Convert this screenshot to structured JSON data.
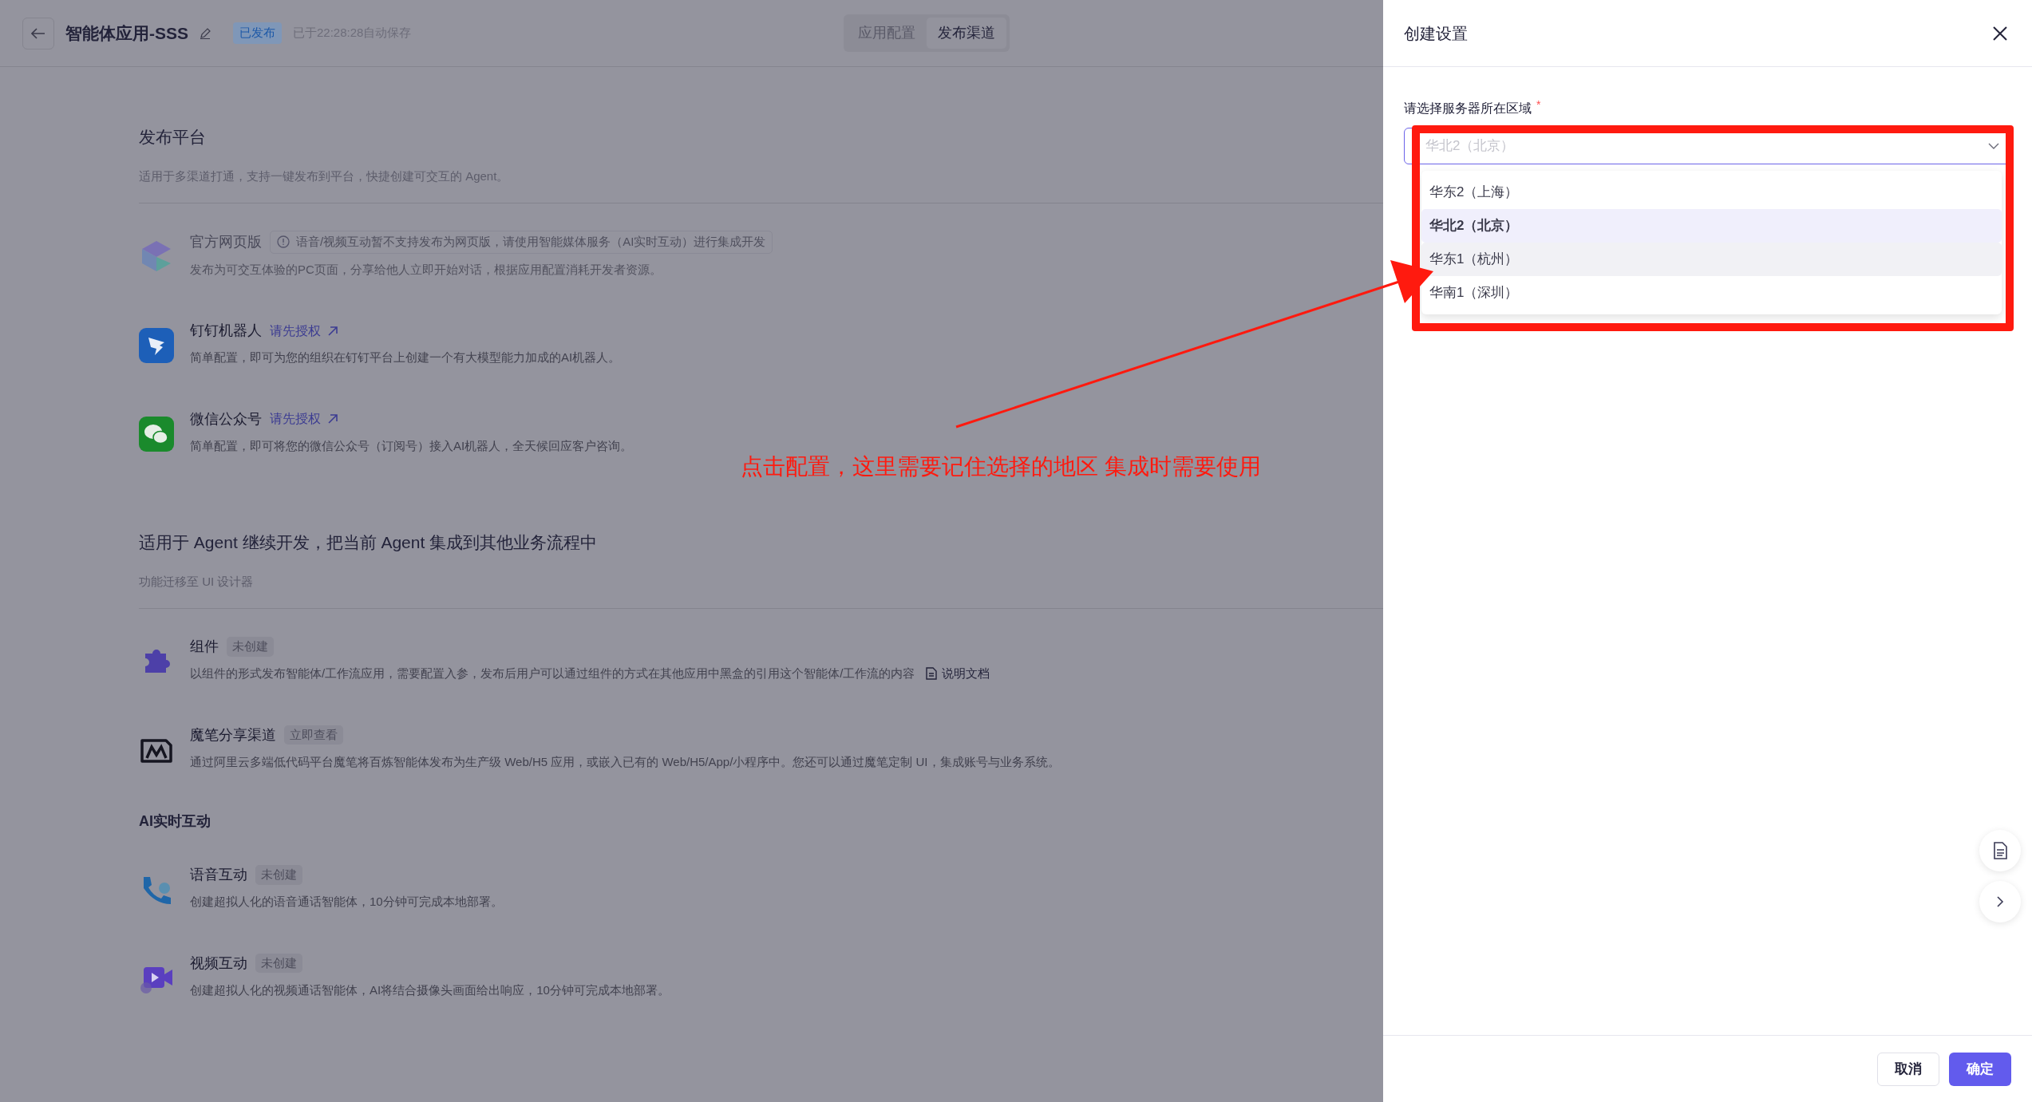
{
  "header": {
    "title": "智能体应用-SSS",
    "status_badge": "已发布",
    "autosave": "已于22:28:28自动保存",
    "tabs": [
      {
        "label": "应用配置",
        "selected": false
      },
      {
        "label": "发布渠道",
        "selected": true
      }
    ]
  },
  "sections": [
    {
      "kind": "group",
      "title": "发布平台",
      "subtitle": "适用于多渠道打通，支持一键发布到平台，快捷创建可交互的 Agent。",
      "items": [
        {
          "kind": "web",
          "name": "官方网页版",
          "disabled": true,
          "notice": "语音/视频互动暂不支持发布为网页版，请使用智能媒体服务（AI实时互动）进行集成开发",
          "description": "发布为可交互体验的PC页面，分享给他人立即开始对话，根据应用配置消耗开发者资源。"
        },
        {
          "kind": "dingtalk",
          "name": "钉钉机器人",
          "disabled": false,
          "link": "请先授权",
          "description": "简单配置，即可为您的组织在钉钉平台上创建一个有大模型能力加成的AI机器人。"
        },
        {
          "kind": "wechat",
          "name": "微信公众号",
          "disabled": false,
          "link": "请先授权",
          "description": "简单配置，即可将您的微信公众号（订阅号）接入AI机器人，全天候回应客户咨询。"
        }
      ]
    },
    {
      "kind": "group",
      "title": "适用于 Agent 继续开发，把当前 Agent 集成到其他业务流程中",
      "subtitle": "功能迁移至 UI 设计器",
      "items": [
        {
          "kind": "component",
          "name": "组件",
          "disabled": false,
          "badge": "未创建",
          "description": "以组件的形式发布智能体/工作流应用，需要配置入参，发布后用户可以通过组件的方式在其他应用中黑盒的引用这个智能体/工作流的内容",
          "doc_link": "说明文档"
        },
        {
          "kind": "mobi",
          "name": "魔笔分享渠道",
          "disabled": false,
          "badge": "立即查看",
          "description": "通过阿里云多端低代码平台魔笔将百炼智能体发布为生产级 Web/H5 应用，或嵌入已有的 Web/H5/App/小程序中。您还可以通过魔笔定制 UI，集成账号与业务系统。"
        }
      ]
    },
    {
      "kind": "subgroup",
      "title": "AI实时互动",
      "items": [
        {
          "kind": "voice",
          "name": "语音互动",
          "disabled": false,
          "badge": "未创建",
          "description": "创建超拟人化的语音通话智能体，10分钟可完成本地部署。"
        },
        {
          "kind": "video",
          "name": "视频互动",
          "disabled": false,
          "badge": "未创建",
          "description": "创建超拟人化的视频通话智能体，AI将结合摄像头画面给出响应，10分钟可完成本地部署。"
        }
      ]
    }
  ],
  "drawer": {
    "title": "创建设置",
    "field": {
      "label": "请选择服务器所在区域",
      "required_mark": "*",
      "placeholder": "华北2（北京）",
      "options": [
        {
          "label": "华东2（上海）",
          "selected": false,
          "hovered": false
        },
        {
          "label": "华北2（北京）",
          "selected": true,
          "hovered": false
        },
        {
          "label": "华东1（杭州）",
          "selected": false,
          "hovered": true
        },
        {
          "label": "华南1（深圳）",
          "selected": false,
          "hovered": false
        }
      ]
    },
    "buttons": [
      {
        "label": "取消",
        "kind": "secondary"
      },
      {
        "label": "确定",
        "kind": "primary"
      }
    ]
  },
  "annotation": {
    "text": "点击配置，这里需要记住选择的地区 集成时需要使用"
  }
}
